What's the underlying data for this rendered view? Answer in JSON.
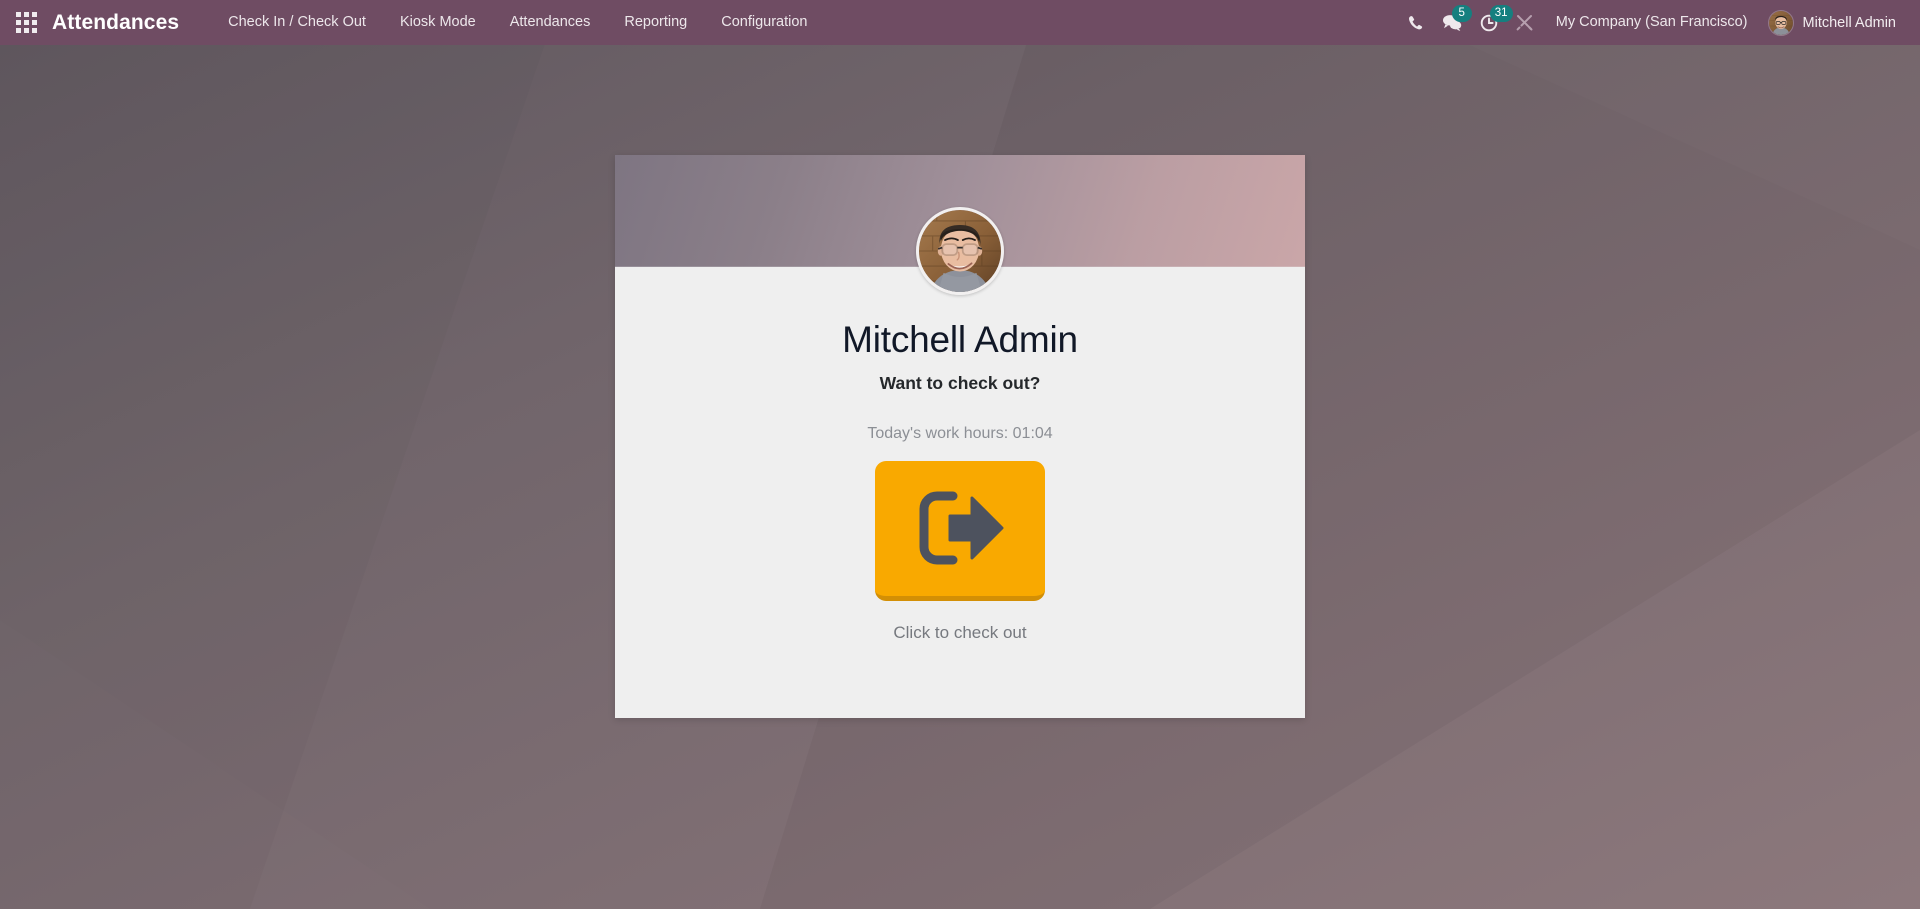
{
  "navbar": {
    "apps_menu_icon": "apps-grid-icon",
    "brand": "Attendances",
    "menus": [
      {
        "label": "Check In / Check Out"
      },
      {
        "label": "Kiosk Mode"
      },
      {
        "label": "Attendances"
      },
      {
        "label": "Reporting"
      },
      {
        "label": "Configuration"
      }
    ],
    "systray": {
      "phone_icon": "phone-icon",
      "messages_icon": "chat-bubbles-icon",
      "messages_count": "5",
      "activities_icon": "clock-activity-icon",
      "activities_count": "31",
      "debug_icon": "wrench-tools-icon"
    },
    "company": "My Company (San Francisco)",
    "user": {
      "name": "Mitchell Admin",
      "avatar_icon": "user-avatar"
    }
  },
  "card": {
    "avatar_icon": "employee-avatar",
    "employee_name": "Mitchell Admin",
    "prompt": "Want to check out?",
    "work_hours_label": "Today's work hours: 01:04",
    "checkout_icon": "sign-out-icon",
    "checkout_caption": "Click to check out"
  },
  "colors": {
    "navbar": "#6f4c63",
    "badge_teal": "#157f7f",
    "checkout_orange": "#f9a900",
    "checkout_orange_shadow": "#d38f05",
    "checkout_icon_slate": "#4d525e",
    "card_background": "#efefef",
    "page_background": "#7a6a71"
  }
}
